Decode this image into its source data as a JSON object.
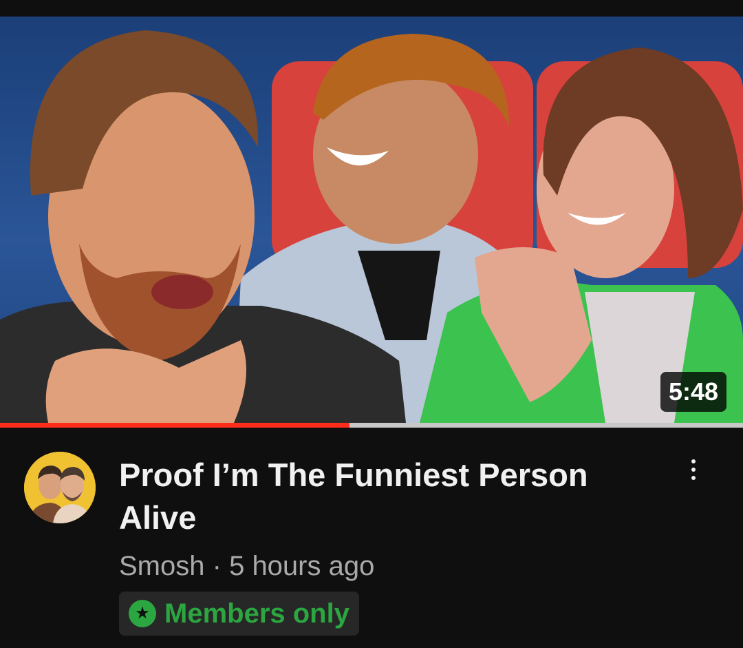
{
  "video": {
    "duration": "5:48",
    "watch_progress_percent": 47,
    "title": "Proof I’m The Funniest Person Alive",
    "channel": "Smosh",
    "separator": "·",
    "published": "5 hours ago",
    "badge_label": "Members only",
    "badge_icon": "star-circle-icon",
    "more_icon": "kebab-menu-icon"
  },
  "colors": {
    "background": "#0f0f0f",
    "progress": "#ff2d1a",
    "members_green": "#2ba640",
    "secondary_text": "#aaaaaa",
    "avatar_bg": "#f0c232"
  }
}
